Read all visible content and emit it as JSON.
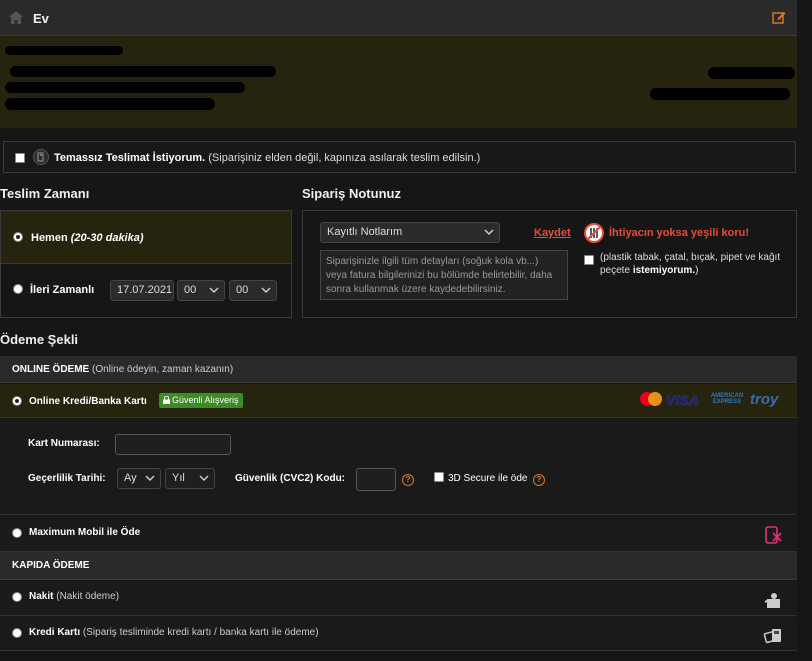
{
  "address": {
    "title": "Ev"
  },
  "contactless": {
    "title": "Temassız Teslimat İstiyorum.",
    "description": "(Siparişiniz elden değil, kapınıza asılarak teslim edilsin.)"
  },
  "delivery": {
    "heading": "Teslim Zamanı",
    "now_label": "Hemen",
    "now_detail": "(20-30 dakika)",
    "later_label": "İleri Zamanlı",
    "date": "17.07.2021",
    "hour": "00",
    "minute": "00"
  },
  "order_note": {
    "heading": "Sipariş Notunuz",
    "saved_notes_select": "Kayıtlı Notlarım",
    "save_label": "Kaydet",
    "placeholder": "Siparişinizle ilgili tüm detayları (soğuk kola vb...) veya fatura bilgilerinizi bu bölümde belirtebilir, daha sonra kullanmak üzere kaydedebilirsiniz.",
    "green_title": "İhtiyacın yoksa yeşili koru!",
    "green_text_prefix": "(plastik tabak, çatal, bıçak, pipet ve kağıt peçete",
    "green_text_bold": "istemiyorum.",
    "green_text_suffix": ")"
  },
  "payment": {
    "heading": "Ödeme Şekli",
    "online_header": "ONLINE ÖDEME",
    "online_header_note": "(Online ödeyin, zaman kazanın)",
    "online_card_label": "Online Kredi/Banka Kartı",
    "secure_badge": "Güvenli Alışveriş",
    "card_brands": [
      "VISA",
      "AMERICAN EXPRESS",
      "troy"
    ],
    "card_number_label": "Kart Numarası:",
    "expiry_label": "Geçerlilik Tarihi:",
    "month_placeholder": "Ay",
    "year_placeholder": "Yıl",
    "cvc_label": "Güvenlik (CVC2) Kodu:",
    "secure3d_label": "3D Secure ile öde",
    "maximum_label": "Maximum Mobil ile Öde",
    "door_header": "KAPIDA ÖDEME",
    "cash_label": "Nakit",
    "cash_note": "(Nakit ödeme)",
    "credit_label": "Kredi Kartı",
    "credit_note": "(Sipariş tesliminde kredi kartı / banka kartı ile ödeme)"
  },
  "colors": {
    "accent_red": "#e84b3a",
    "selected_row_bg": "#26240f",
    "secure_green": "#3c8b26",
    "question_orange": "#e07a1f",
    "maximum_pink": "#e0307a"
  }
}
